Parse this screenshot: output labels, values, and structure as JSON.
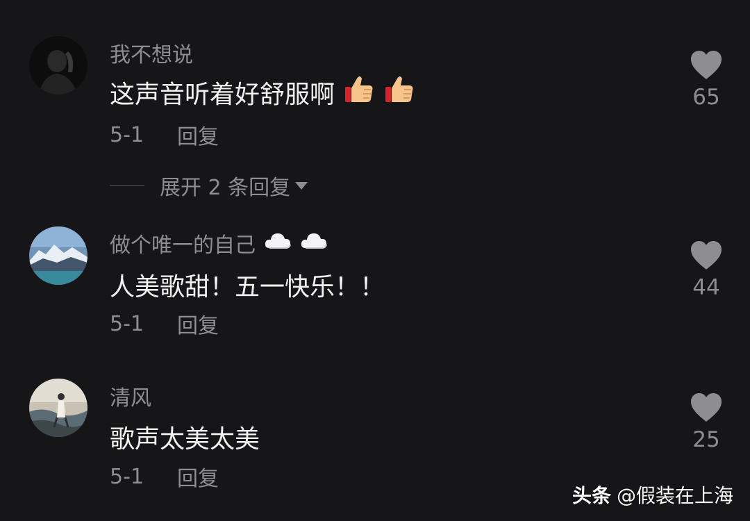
{
  "comments": [
    {
      "username": "我不想说",
      "content": "这声音听着好舒服啊",
      "content_emojis": [
        "thumbs-up",
        "thumbs-up"
      ],
      "date": "5-1",
      "reply_label": "回复",
      "likes": "65"
    },
    {
      "username": "做个唯一的自己",
      "username_emojis": [
        "cloud",
        "cloud"
      ],
      "content": "人美歌甜！五一快乐！！",
      "date": "5-1",
      "reply_label": "回复",
      "likes": "44"
    },
    {
      "username": "清风",
      "content": "歌声太美太美",
      "date": "5-1",
      "reply_label": "回复",
      "likes": "25"
    }
  ],
  "expand_replies": {
    "label": "展开 2 条回复"
  },
  "watermark": {
    "brand": "头条",
    "handle": "@假装在上海"
  },
  "colors": {
    "background": "#161618",
    "secondary_text": "#8d8d92",
    "primary_text": "#f2f2f2",
    "heart": "#8d8d92"
  }
}
